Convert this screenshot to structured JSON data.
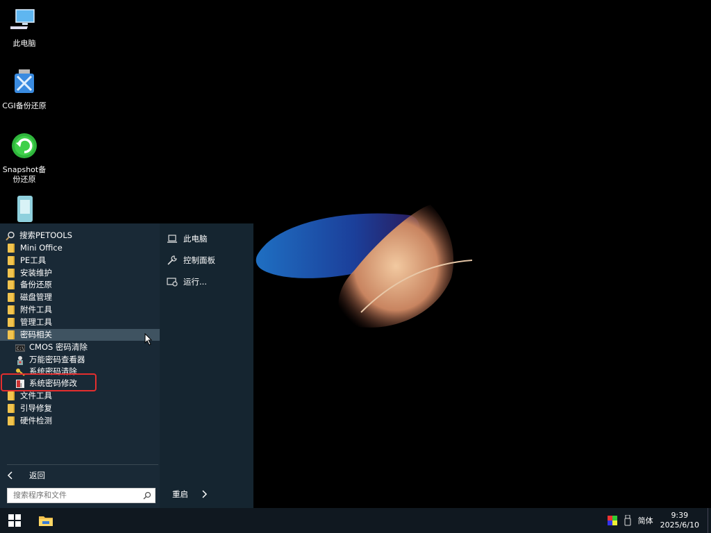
{
  "desktop": {
    "icons": [
      {
        "label": "此电脑",
        "icon": "computer-icon"
      },
      {
        "label": "CGI备份还原",
        "icon": "cgi-backup-icon"
      },
      {
        "label": "Snapshot备份还原",
        "icon": "snapshot-icon"
      },
      {
        "label": "",
        "icon": "app-icon"
      }
    ]
  },
  "start_menu": {
    "search_petools": "搜索PETOOLS",
    "items": [
      "Mini Office",
      "PE工具",
      "安装维护",
      "备份还原",
      "磁盘管理",
      "附件工具",
      "管理工具",
      "密码相关"
    ],
    "sub_items": [
      {
        "label": "CMOS 密码清除",
        "icon": "cmos-icon"
      },
      {
        "label": "万能密码查看器",
        "icon": "password-viewer-icon"
      },
      {
        "label": "系统密码清除",
        "icon": "key-icon"
      },
      {
        "label": "系统密码修改",
        "icon": "password-change-icon"
      }
    ],
    "items_after": [
      "文件工具",
      "引导修复",
      "硬件检测"
    ],
    "back_label": "返回",
    "search_placeholder": "搜索程序和文件",
    "right": {
      "computer": "此电脑",
      "control_panel": "控制面板",
      "run": "运行...",
      "restart": "重启"
    }
  },
  "taskbar": {
    "ime": "简体",
    "time": "9:39",
    "date": "2025/6/10"
  },
  "colors": {
    "highlight_border": "#e52e2e",
    "folder": "#f1c44f",
    "menu_bg": "#1a2a36"
  }
}
